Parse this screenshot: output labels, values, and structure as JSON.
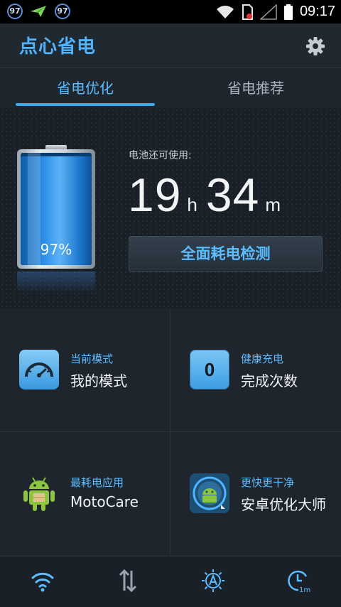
{
  "status_bar": {
    "notif_badge_1": "97",
    "notif_badge_2": "97",
    "time": "09:17",
    "icons": [
      "notification-badge-icon",
      "paper-plane-icon",
      "notification-badge-icon",
      "wifi-icon",
      "sim-error-icon",
      "signal-icon",
      "battery-icon"
    ]
  },
  "header": {
    "title": "点心省电",
    "settings_icon": "gear-icon"
  },
  "tabs": [
    {
      "label": "省电优化",
      "active": true
    },
    {
      "label": "省电推荐",
      "active": false
    }
  ],
  "battery": {
    "level_percent": 97,
    "level_text": "97%",
    "remaining_label": "电池还可使用:",
    "hours": "19",
    "hours_unit": "h",
    "minutes": "34",
    "minutes_unit": "m",
    "detect_button": "全面耗电检测"
  },
  "grid": [
    {
      "small": "当前模式",
      "big": "我的模式",
      "icon": "speedometer-icon"
    },
    {
      "small": "健康充电",
      "big": "完成次数",
      "icon": "counter-icon",
      "counter": "0"
    },
    {
      "small": "最耗电应用",
      "big": "MotoCare",
      "icon": "android-app-icon"
    },
    {
      "small": "更快更干净",
      "big": "安卓优化大师",
      "icon": "optimizer-app-icon"
    }
  ],
  "bottom_bar": {
    "icons": [
      "wifi-toggle-icon",
      "data-toggle-icon",
      "brightness-auto-icon",
      "screen-timeout-icon"
    ],
    "timeout_label": "1m"
  },
  "colors": {
    "accent": "#4fb4ff",
    "background": "#1b2129"
  }
}
